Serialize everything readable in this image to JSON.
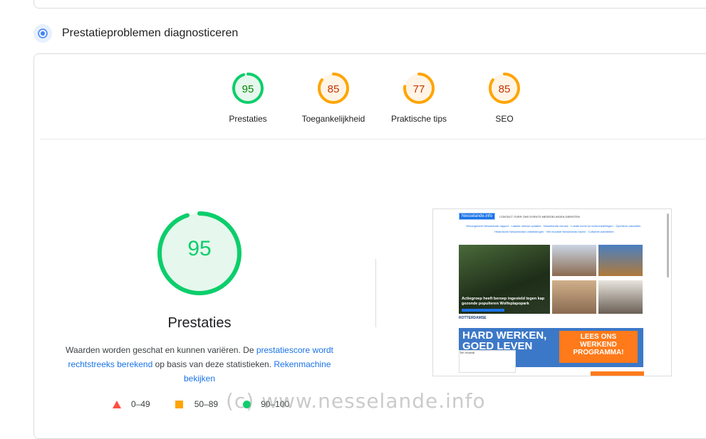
{
  "section": {
    "title": "Prestatieproblemen diagnosticeren"
  },
  "colors": {
    "green": "#0cce6b",
    "orange": "#ffa400",
    "red": "#ff4e42",
    "link": "#1a73e8"
  },
  "gauges": [
    {
      "score": "95",
      "label": "Prestaties",
      "fraction": 0.95,
      "color": "#0cce6b",
      "text_color": "#008800",
      "bg": "#e6f7ed"
    },
    {
      "score": "85",
      "label": "Toegankelijkheid",
      "fraction": 0.85,
      "color": "#ffa400",
      "text_color": "#c33300",
      "bg": "#fff4e5"
    },
    {
      "score": "77",
      "label": "Praktische tips",
      "fraction": 0.77,
      "color": "#ffa400",
      "text_color": "#c33300",
      "bg": "#fff4e5"
    },
    {
      "score": "85",
      "label": "SEO",
      "fraction": 0.85,
      "color": "#ffa400",
      "text_color": "#c33300",
      "bg": "#fff4e5"
    }
  ],
  "main": {
    "score": "95",
    "fraction": 0.95,
    "title": "Prestaties",
    "desc_part1": "Waarden worden geschat en kunnen variëren. De ",
    "desc_link1": "prestatiescore wordt rechtstreeks berekend",
    "desc_part2": " op basis van deze statistieken. ",
    "desc_link2": "Rekenmachine bekijken"
  },
  "legend": [
    {
      "label": "0–49",
      "shape": "triangle"
    },
    {
      "label": "50–89",
      "shape": "square"
    },
    {
      "label": "90–100",
      "shape": "circle"
    }
  ],
  "thumbnail": {
    "logo": "Nesselande.info",
    "menu": "CONTACT  OVER ONS  EVENTS  MEDEDELINGEN  DIENSTEN",
    "links": "Woningmarkt Nesselande rapport · Laatste nieuws updates · Nesselande nieuws · Lokale kunst en tentoonstellingen · Sportieve vakanties · Historische Nesselandse ontdekkingen · Het mooiste Nesselands haven · Culturele activiteiten",
    "hero_caption": "Actiegroep heeft beroep ingesteld tegen kap gezonde populieren Wolfeplapopark",
    "sub": "ROTTERDAMSE",
    "banner_left": "HARD WERKEN,\nGOED LEVEN",
    "banner_right": "LEES ONS\nWERKEND\nPROGRAMMA!",
    "card_bot": "Tim Hoornik"
  },
  "watermark": "(c) www.nesselande.info"
}
